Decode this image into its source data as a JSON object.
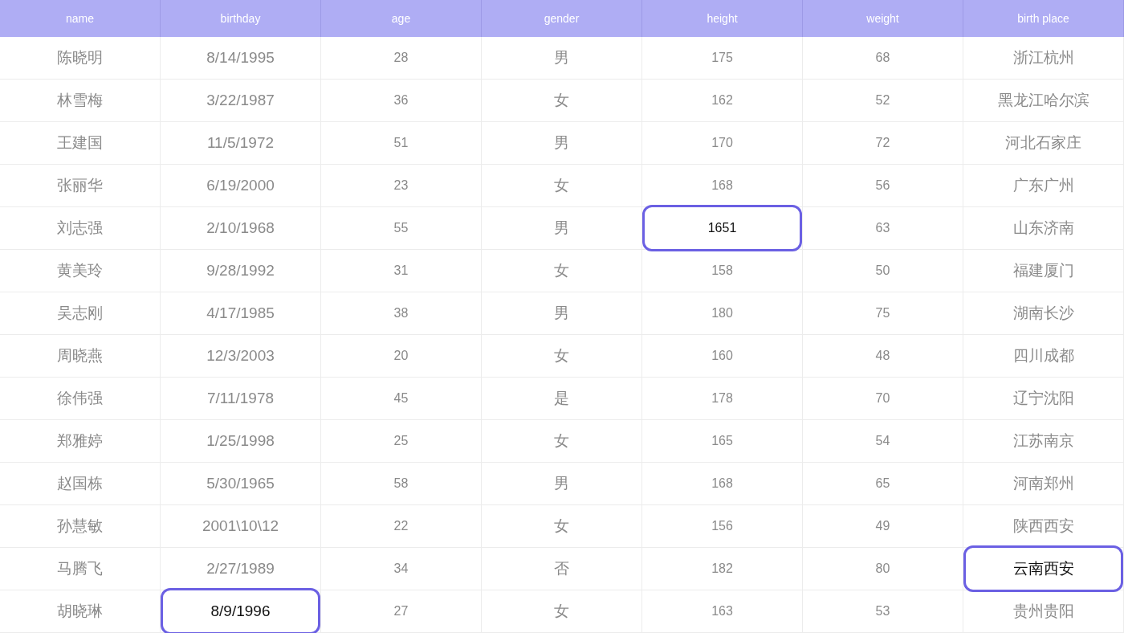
{
  "table": {
    "columns": [
      "name",
      "birthday",
      "age",
      "gender",
      "height",
      "weight",
      "birth place"
    ],
    "rows": [
      {
        "cells": [
          {
            "text": "陈晓明",
            "selected": false
          },
          {
            "text": "8/14/1995",
            "selected": false
          },
          {
            "text": "28",
            "selected": false
          },
          {
            "text": "男",
            "selected": false
          },
          {
            "text": "175",
            "selected": false
          },
          {
            "text": "68",
            "selected": false
          },
          {
            "text": "浙江杭州",
            "selected": false
          }
        ]
      },
      {
        "cells": [
          {
            "text": "林雪梅",
            "selected": false
          },
          {
            "text": "3/22/1987",
            "selected": false
          },
          {
            "text": "36",
            "selected": false
          },
          {
            "text": "女",
            "selected": false
          },
          {
            "text": "162",
            "selected": false
          },
          {
            "text": "52",
            "selected": false
          },
          {
            "text": "黑龙江哈尔滨",
            "selected": false
          }
        ]
      },
      {
        "cells": [
          {
            "text": "王建国",
            "selected": false
          },
          {
            "text": "11/5/1972",
            "selected": false
          },
          {
            "text": "51",
            "selected": false
          },
          {
            "text": "男",
            "selected": false
          },
          {
            "text": "170",
            "selected": false
          },
          {
            "text": "72",
            "selected": false
          },
          {
            "text": "河北石家庄",
            "selected": false
          }
        ]
      },
      {
        "cells": [
          {
            "text": "张丽华",
            "selected": false
          },
          {
            "text": "6/19/2000",
            "selected": false
          },
          {
            "text": "23",
            "selected": false
          },
          {
            "text": "女",
            "selected": false
          },
          {
            "text": "168",
            "selected": false
          },
          {
            "text": "56",
            "selected": false
          },
          {
            "text": "广东广州",
            "selected": false
          }
        ]
      },
      {
        "cells": [
          {
            "text": "刘志强",
            "selected": false
          },
          {
            "text": "2/10/1968",
            "selected": false
          },
          {
            "text": "55",
            "selected": false
          },
          {
            "text": "男",
            "selected": false
          },
          {
            "text": "1651",
            "selected": true
          },
          {
            "text": "63",
            "selected": false
          },
          {
            "text": "山东济南",
            "selected": false
          }
        ]
      },
      {
        "cells": [
          {
            "text": "黄美玲",
            "selected": false
          },
          {
            "text": "9/28/1992",
            "selected": false
          },
          {
            "text": "31",
            "selected": false
          },
          {
            "text": "女",
            "selected": false
          },
          {
            "text": "158",
            "selected": false
          },
          {
            "text": "50",
            "selected": false
          },
          {
            "text": "福建厦门",
            "selected": false
          }
        ]
      },
      {
        "cells": [
          {
            "text": "吴志刚",
            "selected": false
          },
          {
            "text": "4/17/1985",
            "selected": false
          },
          {
            "text": "38",
            "selected": false
          },
          {
            "text": "男",
            "selected": false
          },
          {
            "text": "180",
            "selected": false
          },
          {
            "text": "75",
            "selected": false
          },
          {
            "text": "湖南长沙",
            "selected": false
          }
        ]
      },
      {
        "cells": [
          {
            "text": "周晓燕",
            "selected": false
          },
          {
            "text": "12/3/2003",
            "selected": false
          },
          {
            "text": "20",
            "selected": false
          },
          {
            "text": "女",
            "selected": false
          },
          {
            "text": "160",
            "selected": false
          },
          {
            "text": "48",
            "selected": false
          },
          {
            "text": "四川成都",
            "selected": false
          }
        ]
      },
      {
        "cells": [
          {
            "text": "徐伟强",
            "selected": false
          },
          {
            "text": "7/11/1978",
            "selected": false
          },
          {
            "text": "45",
            "selected": false
          },
          {
            "text": "是",
            "selected": false
          },
          {
            "text": "178",
            "selected": false
          },
          {
            "text": "70",
            "selected": false
          },
          {
            "text": "辽宁沈阳",
            "selected": false
          }
        ]
      },
      {
        "cells": [
          {
            "text": "郑雅婷",
            "selected": false
          },
          {
            "text": "1/25/1998",
            "selected": false
          },
          {
            "text": "25",
            "selected": false
          },
          {
            "text": "女",
            "selected": false
          },
          {
            "text": "165",
            "selected": false
          },
          {
            "text": "54",
            "selected": false
          },
          {
            "text": "江苏南京",
            "selected": false
          }
        ]
      },
      {
        "cells": [
          {
            "text": "赵国栋",
            "selected": false
          },
          {
            "text": "5/30/1965",
            "selected": false
          },
          {
            "text": "58",
            "selected": false
          },
          {
            "text": "男",
            "selected": false
          },
          {
            "text": "168",
            "selected": false
          },
          {
            "text": "65",
            "selected": false
          },
          {
            "text": "河南郑州",
            "selected": false
          }
        ]
      },
      {
        "cells": [
          {
            "text": "孙慧敏",
            "selected": false
          },
          {
            "text": "2001\\10\\12",
            "selected": false
          },
          {
            "text": "22",
            "selected": false
          },
          {
            "text": "女",
            "selected": false
          },
          {
            "text": "156",
            "selected": false
          },
          {
            "text": "49",
            "selected": false
          },
          {
            "text": "陕西西安",
            "selected": false
          }
        ]
      },
      {
        "cells": [
          {
            "text": "马腾飞",
            "selected": false
          },
          {
            "text": "2/27/1989",
            "selected": false
          },
          {
            "text": "34",
            "selected": false
          },
          {
            "text": "否",
            "selected": false
          },
          {
            "text": "182",
            "selected": false
          },
          {
            "text": "80",
            "selected": false
          },
          {
            "text": "云南西安",
            "selected": true
          }
        ]
      },
      {
        "cells": [
          {
            "text": "胡晓琳",
            "selected": false
          },
          {
            "text": "8/9/1996",
            "selected": true
          },
          {
            "text": "27",
            "selected": false
          },
          {
            "text": "女",
            "selected": false
          },
          {
            "text": "163",
            "selected": false
          },
          {
            "text": "53",
            "selected": false
          },
          {
            "text": "贵州贵阳",
            "selected": false
          }
        ]
      }
    ]
  }
}
